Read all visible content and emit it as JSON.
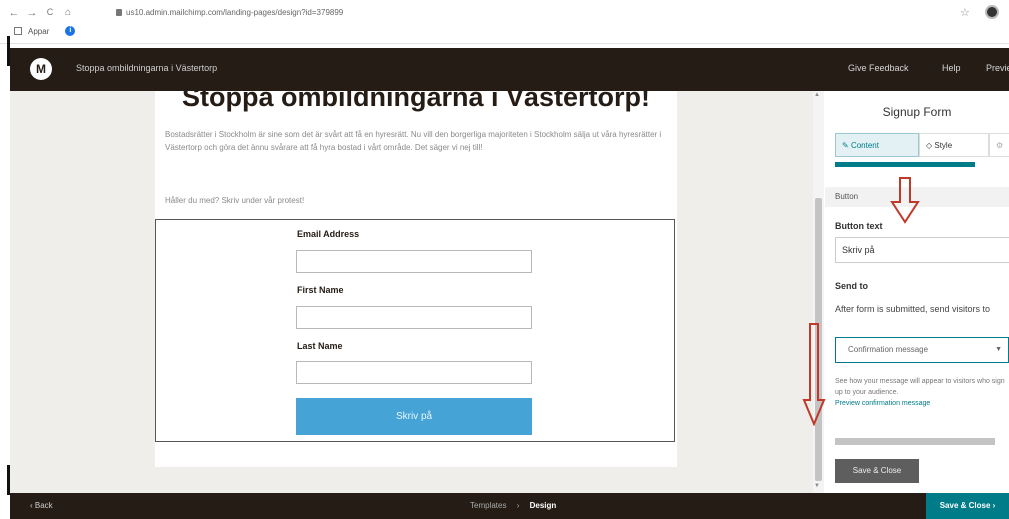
{
  "browser": {
    "back_icon": "←",
    "forward_icon": "→",
    "reload_icon": "C",
    "home_icon": "⌂",
    "url": "us10.admin.mailchimp.com/landing-pages/design?id=379899",
    "bookmark_label": "Appar",
    "info_icon": "i",
    "star_icon": "☆"
  },
  "header": {
    "logo": "M",
    "title": "Stoppa ombildningarna i Västertorp",
    "links": [
      "Give Feedback",
      "Help",
      "Preview"
    ]
  },
  "form": {
    "title": "Stoppa ombildningarna i Västertorp!",
    "intro": "Bostadsrätter i Stockholm är sine som det är svårt att få en hyresrätt. Nu vill den borgerliga majoriteten i Stockholm sälja ut våra hyresrätter i Västertorp och göra det ännu svårare att få hyra bostad i vårt område. Det säger vi nej till!",
    "cta": "Håller du med? Skriv under vår protest!",
    "fields": [
      {
        "label": "Email Address"
      },
      {
        "label": "First Name"
      },
      {
        "label": "Last Name"
      }
    ],
    "submit_label": "Skriv på"
  },
  "panel": {
    "title": "Signup Form",
    "tabs": {
      "content": "Content",
      "style": "Style",
      "more": "⚙"
    },
    "section": "Button",
    "button_text_label": "Button text",
    "button_text_value": "Skriv på",
    "send_to_label": "Send to",
    "send_to_desc": "After form is submitted, send visitors to",
    "select_value": "Confirmation message",
    "select_caret": "▼",
    "hint": "See how your message will appear to visitors who sign up to your audience.",
    "hint_link": "Preview confirmation message",
    "save_close": "Save & Close"
  },
  "footer": {
    "back": "‹ Back",
    "steps": [
      "Templates",
      "Design"
    ],
    "separator": "›",
    "save_close": "Save & Close ›"
  },
  "colors": {
    "header_bg": "#241c15",
    "accent_teal": "#007c89",
    "button_blue": "#45a3d6",
    "annotation_red": "#c0392b"
  }
}
